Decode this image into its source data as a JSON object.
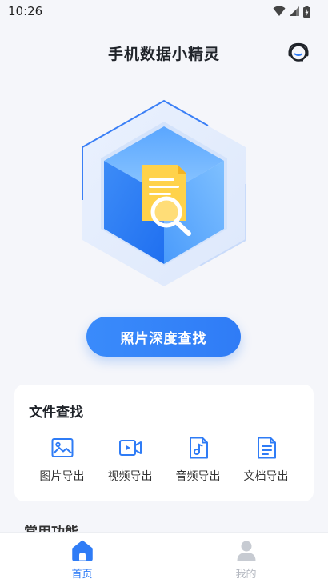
{
  "status_bar": {
    "time": "10:26",
    "icons": [
      "wifi-icon",
      "cell-signal-icon",
      "battery-icon"
    ]
  },
  "header": {
    "title": "手机数据小精灵",
    "support_icon": "headset-icon"
  },
  "hero": {
    "icon": "hexagon-document-search-illustration"
  },
  "primary_action": {
    "label": "照片深度查找"
  },
  "file_search": {
    "title": "文件查找",
    "items": [
      {
        "label": "图片导出",
        "icon": "image-icon"
      },
      {
        "label": "视频导出",
        "icon": "video-icon"
      },
      {
        "label": "音频导出",
        "icon": "music-file-icon"
      },
      {
        "label": "文档导出",
        "icon": "document-icon"
      }
    ]
  },
  "common_functions": {
    "title": "常用功能"
  },
  "tabbar": {
    "tabs": [
      {
        "label": "首页",
        "icon": "home-icon",
        "active": true
      },
      {
        "label": "我的",
        "icon": "profile-icon",
        "active": false
      }
    ]
  },
  "colors": {
    "accent": "#2f7cf6",
    "background": "#f5f6fa",
    "inactive": "#b5b9c1"
  }
}
